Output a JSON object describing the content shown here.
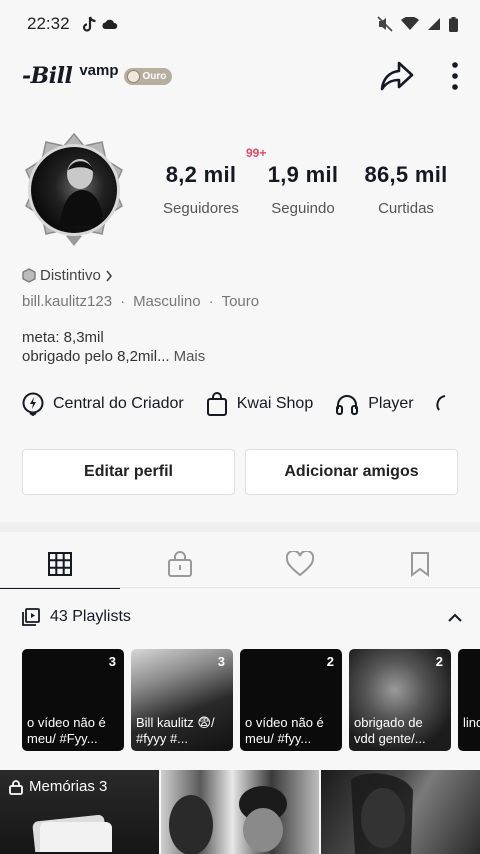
{
  "status_bar": {
    "time": "22:32"
  },
  "profile": {
    "display_name": "-Bill",
    "vamp_label": "vamp",
    "badge_label": "Ouro",
    "notification_badge": "99+",
    "stats": [
      {
        "value": "8,2 mil",
        "label": "Seguidores"
      },
      {
        "value": "1,9 mil",
        "label": "Seguindo"
      },
      {
        "value": "86,5 mil",
        "label": "Curtidas"
      }
    ],
    "distintivo_label": "Distintivo",
    "username": "bill.kaulitz123",
    "gender": "Masculino",
    "sign": "Touro",
    "bio_line1": "meta: 8,3mil",
    "bio_line2": "obrigado pelo 8,2mil...",
    "bio_more": "Mais"
  },
  "shortcuts": [
    {
      "label": "Central do Criador",
      "icon": "lightning-circle-icon"
    },
    {
      "label": "Kwai Shop",
      "icon": "shopping-bag-icon"
    },
    {
      "label": "Player",
      "icon": "headphones-icon"
    }
  ],
  "buttons": {
    "edit_profile": "Editar perfil",
    "add_friends": "Adicionar amigos"
  },
  "tabs": [
    "grid-icon",
    "lock-bag-icon",
    "heart-icon",
    "bookmark-icon"
  ],
  "playlist_header": {
    "label": "43 Playlists"
  },
  "playlists": [
    {
      "count": "3",
      "title": "o vídeo não é meu/ #Fyy..."
    },
    {
      "count": "3",
      "title": "Bill kaulitz 😨/ #fyyy #..."
    },
    {
      "count": "2",
      "title": "o vídeo não é meu/ #fyy..."
    },
    {
      "count": "2",
      "title": "obrigado de vdd gente/..."
    },
    {
      "count": "",
      "title": "lind #fy"
    }
  ],
  "memorias_label": "Memórias 3",
  "colors": {
    "accent": "#e0486a",
    "text": "#161823",
    "background": "#f7f7f7"
  }
}
